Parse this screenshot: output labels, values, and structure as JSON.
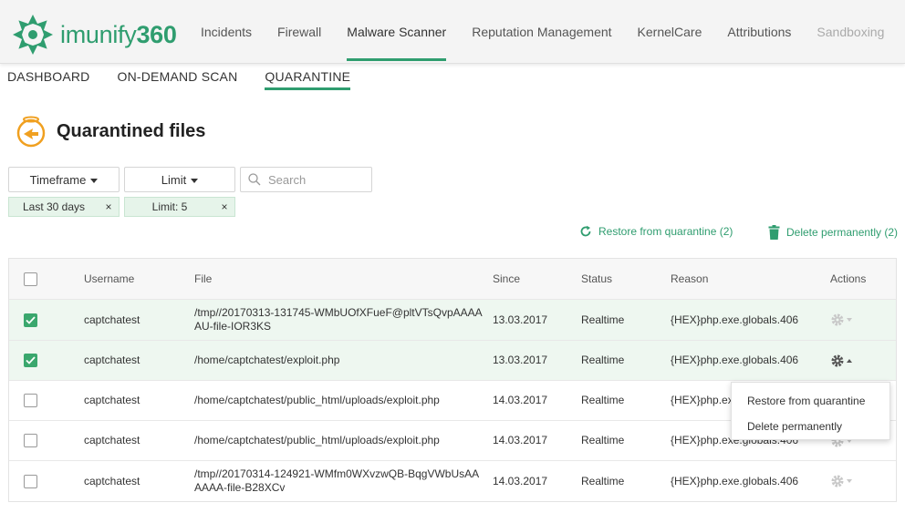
{
  "app": {
    "brand_name": "imunify",
    "brand_number": "360",
    "accent_color": "#2f9d6f"
  },
  "nav": {
    "tabs": [
      {
        "label": "Incidents"
      },
      {
        "label": "Firewall"
      },
      {
        "label": "Malware Scanner"
      },
      {
        "label": "Reputation Management"
      },
      {
        "label": "KernelCare"
      },
      {
        "label": "Attributions"
      },
      {
        "label": "Sandboxing"
      }
    ],
    "active": "Malware Scanner"
  },
  "subnav": {
    "tabs": [
      {
        "label": "DASHBOARD"
      },
      {
        "label": "ON-DEMAND SCAN"
      },
      {
        "label": "QUARANTINE"
      }
    ],
    "active": "QUARANTINE"
  },
  "page": {
    "title": "Quarantined files",
    "title_icon": "quarantine-fishbowl-icon"
  },
  "filters": {
    "timeframe_label": "Timeframe",
    "limit_label": "Limit",
    "search_placeholder": "Search",
    "search_value": "",
    "chips": [
      {
        "label": "Last 30 days"
      },
      {
        "label": "Limit: 5"
      }
    ],
    "chip_remove": "×"
  },
  "actions": {
    "restore_label": "Restore from quarantine (2)",
    "delete_label": "Delete permanently (2)"
  },
  "table": {
    "columns": [
      "Username",
      "File",
      "Since",
      "Status",
      "Reason",
      "Actions"
    ],
    "rows": [
      {
        "checked": true,
        "username": "captchatest",
        "file": "/tmp//20170313-131745-WMbUOfXFueF@pltVTsQvpAAAAAU-file-IOR3KS",
        "since": "13.03.2017",
        "status": "Realtime",
        "reason": "{HEX}php.exe.globals.406"
      },
      {
        "checked": true,
        "username": "captchatest",
        "file": "/home/captchatest/exploit.php",
        "since": "13.03.2017",
        "status": "Realtime",
        "reason": "{HEX}php.exe.globals.406"
      },
      {
        "checked": false,
        "username": "captchatest",
        "file": "/home/captchatest/public_html/uploads/exploit.php",
        "since": "14.03.2017",
        "status": "Realtime",
        "reason": "{HEX}php.exe.globals.406"
      },
      {
        "checked": false,
        "username": "captchatest",
        "file": "/home/captchatest/public_html/uploads/exploit.php",
        "since": "14.03.2017",
        "status": "Realtime",
        "reason": "{HEX}php.exe.globals.406"
      },
      {
        "checked": false,
        "username": "captchatest",
        "file": "/tmp//20170314-124921-WMfm0WXvzwQB-BqgVWbUsAAAAAA-file-B28XCv",
        "since": "14.03.2017",
        "status": "Realtime",
        "reason": "{HEX}php.exe.globals.406"
      }
    ]
  },
  "dropdown": {
    "items": [
      {
        "label": "Restore from quarantine"
      },
      {
        "label": "Delete permanently"
      }
    ]
  }
}
